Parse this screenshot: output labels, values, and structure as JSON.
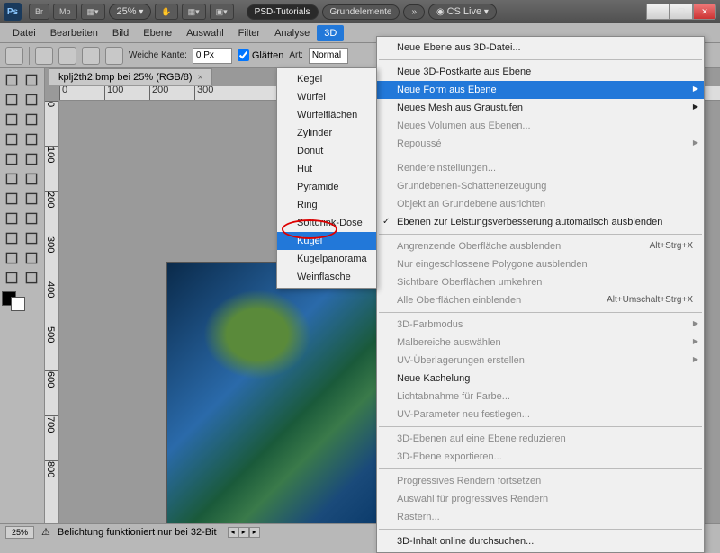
{
  "titlebar": {
    "logo": "Ps",
    "btn_br": "Br",
    "btn_mb": "Mb",
    "zoom": "25%",
    "psd_tutorials": "PSD-Tutorials",
    "grundelemente": "Grundelemente",
    "cs_live": "CS Live"
  },
  "menu": {
    "items": [
      "Datei",
      "Bearbeiten",
      "Bild",
      "Ebene",
      "Auswahl",
      "Filter",
      "Analyse",
      "3D"
    ],
    "active_index": 7
  },
  "options": {
    "weiche_kante_label": "Weiche Kante:",
    "weiche_kante_value": "0 Px",
    "glaetten": "Glätten",
    "art_label": "Art:",
    "art_value": "Normal"
  },
  "doc_tab": "kplj2th2.bmp bei 25% (RGB/8)",
  "ruler_h": [
    "0",
    "100",
    "200",
    "300"
  ],
  "ruler_v": [
    "0",
    "100",
    "200",
    "300",
    "400",
    "500",
    "600",
    "700",
    "800"
  ],
  "statusbar": {
    "zoom": "25%",
    "warning": "Belichtung funktioniert nur bei 32-Bit"
  },
  "submenu": {
    "items": [
      "Kegel",
      "Würfel",
      "Würfelflächen",
      "Zylinder",
      "Donut",
      "Hut",
      "Pyramide",
      "Ring",
      "Softdrink-Dose",
      "Kugel",
      "Kugelpanorama",
      "Weinflasche"
    ],
    "highlight_index": 9
  },
  "mainmenu": {
    "groups": [
      [
        {
          "label": "Neue Ebene aus 3D-Datei...",
          "enabled": true,
          "arrow": false
        }
      ],
      [
        {
          "label": "Neue 3D-Postkarte aus Ebene",
          "enabled": true,
          "arrow": false
        },
        {
          "label": "Neue Form aus Ebene",
          "enabled": true,
          "arrow": true,
          "hl": true
        },
        {
          "label": "Neues Mesh aus Graustufen",
          "enabled": true,
          "arrow": true
        },
        {
          "label": "Neues Volumen aus Ebenen...",
          "enabled": false,
          "arrow": false
        },
        {
          "label": "Repoussé",
          "enabled": false,
          "arrow": true
        }
      ],
      [
        {
          "label": "Rendereinstellungen...",
          "enabled": false
        },
        {
          "label": "Grundebenen-Schattenerzeugung",
          "enabled": false
        },
        {
          "label": "Objekt an Grundebene ausrichten",
          "enabled": false
        },
        {
          "label": "Ebenen zur Leistungsverbesserung automatisch ausblenden",
          "enabled": true,
          "check": true
        }
      ],
      [
        {
          "label": "Angrenzende Oberfläche ausblenden",
          "enabled": false,
          "shortcut": "Alt+Strg+X"
        },
        {
          "label": "Nur eingeschlossene Polygone ausblenden",
          "enabled": false
        },
        {
          "label": "Sichtbare Oberflächen umkehren",
          "enabled": false
        },
        {
          "label": "Alle Oberflächen einblenden",
          "enabled": false,
          "shortcut": "Alt+Umschalt+Strg+X"
        }
      ],
      [
        {
          "label": "3D-Farbmodus",
          "enabled": false,
          "arrow": true
        },
        {
          "label": "Malbereiche auswählen",
          "enabled": false,
          "arrow": true
        },
        {
          "label": "UV-Überlagerungen erstellen",
          "enabled": false,
          "arrow": true
        },
        {
          "label": "Neue Kachelung",
          "enabled": true
        },
        {
          "label": "Lichtabnahme für Farbe...",
          "enabled": false
        },
        {
          "label": "UV-Parameter neu festlegen...",
          "enabled": false
        }
      ],
      [
        {
          "label": "3D-Ebenen auf eine Ebene reduzieren",
          "enabled": false
        },
        {
          "label": "3D-Ebene exportieren...",
          "enabled": false
        }
      ],
      [
        {
          "label": "Progressives Rendern fortsetzen",
          "enabled": false
        },
        {
          "label": "Auswahl für progressives Rendern",
          "enabled": false
        },
        {
          "label": "Rastern...",
          "enabled": false
        }
      ],
      [
        {
          "label": "3D-Inhalt online durchsuchen...",
          "enabled": true
        }
      ]
    ]
  }
}
